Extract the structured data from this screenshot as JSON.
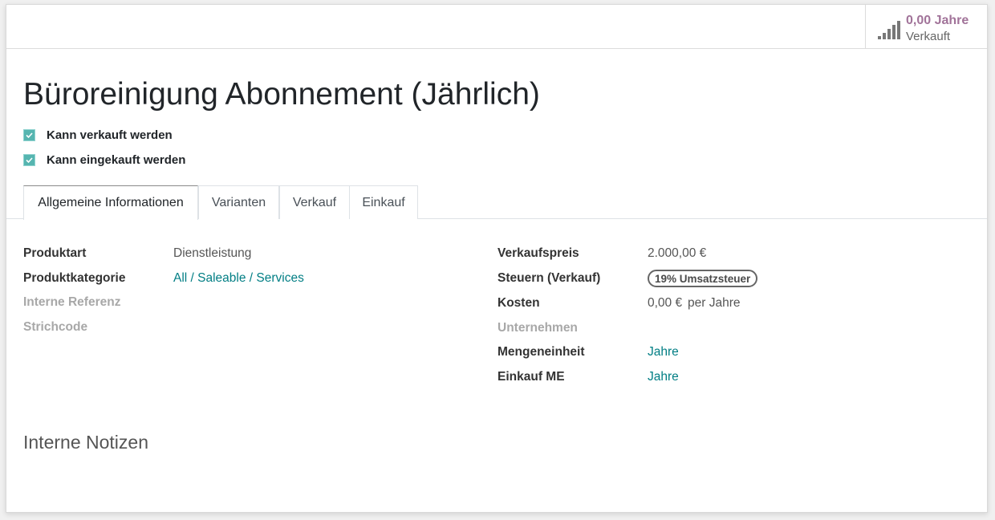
{
  "stat_button": {
    "value": "0,00 Jahre",
    "label": "Verkauft",
    "icon": "signal-bars-icon",
    "value_color": "#a17399"
  },
  "product": {
    "title": "Büroreinigung Abonnement (Jährlich)",
    "can_be_sold": {
      "label": "Kann verkauft werden",
      "checked": true
    },
    "can_be_purchased": {
      "label": "Kann eingekauft werden",
      "checked": true
    }
  },
  "tabs": [
    {
      "label": "Allgemeine Informationen",
      "active": true
    },
    {
      "label": "Varianten",
      "active": false
    },
    {
      "label": "Verkauf",
      "active": false
    },
    {
      "label": "Einkauf",
      "active": false
    }
  ],
  "left_fields": {
    "product_type": {
      "label": "Produktart",
      "value": "Dienstleistung"
    },
    "product_category": {
      "label": "Produktkategorie",
      "value": "All / Saleable / Services"
    },
    "internal_reference": {
      "label": "Interne Referenz",
      "value": ""
    },
    "barcode": {
      "label": "Strichcode",
      "value": ""
    }
  },
  "right_fields": {
    "sales_price": {
      "label": "Verkaufspreis",
      "value": "2.000,00 €"
    },
    "sales_taxes": {
      "label": "Steuern (Verkauf)",
      "tag": "19% Umsatzsteuer"
    },
    "cost": {
      "label": "Kosten",
      "value": "0,00 €",
      "suffix": "per Jahre"
    },
    "company": {
      "label": "Unternehmen",
      "value": ""
    },
    "uom": {
      "label": "Mengeneinheit",
      "value": "Jahre"
    },
    "purchase_uom": {
      "label": "Einkauf ME",
      "value": "Jahre"
    }
  },
  "notes": {
    "title": "Interne Notizen"
  },
  "colors": {
    "accent": "#017e84",
    "checkbox": "#56b5b0"
  }
}
